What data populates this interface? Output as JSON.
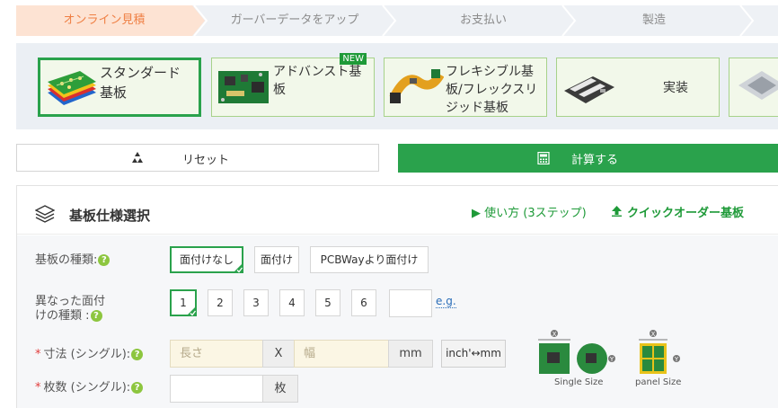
{
  "steps": [
    {
      "label": "オンライン見積",
      "active": true
    },
    {
      "label": "ガーバーデータをアップ",
      "active": false
    },
    {
      "label": "お支払い",
      "active": false
    },
    {
      "label": "製造",
      "active": false
    }
  ],
  "tiles": [
    {
      "label": "スタンダード基板",
      "selected": true
    },
    {
      "label": "アドバンスト基板",
      "badge": "NEW"
    },
    {
      "label": "フレキシブル基板/フレックスリジッド基板"
    },
    {
      "label": "実装"
    }
  ],
  "actions": {
    "reset_label": "リセット",
    "calc_label": "計算する"
  },
  "panel": {
    "title": "基板仕様選択",
    "howto_label": "▶ 使い方 (3ステップ)",
    "quick_label": "クイックオーダー基板"
  },
  "board_type": {
    "label": "基板の種類:",
    "options": [
      "面付けなし",
      "面付け",
      "PCBWayより面付け"
    ]
  },
  "panel_variants": {
    "label_line1": "異なった面付",
    "label_line2": "けの種類 :",
    "options": [
      "1",
      "2",
      "3",
      "4",
      "5",
      "6"
    ],
    "eg_label": "e.g."
  },
  "size": {
    "label": "寸法 (シングル):",
    "length_placeholder": "長さ",
    "separator": "X",
    "width_placeholder": "幅",
    "unit": "mm",
    "toggle_label": "inch'↔mm"
  },
  "quantity": {
    "label": "枚数 (シングル):",
    "unit": "枚"
  },
  "diagram": {
    "single_caption": "Single Size",
    "panel_caption": "panel Size"
  },
  "colors": {
    "accent_green": "#2aa24c",
    "step_active_bg": "#fde3d3",
    "step_active_text": "#ef7f43",
    "link_green": "#1e9a38"
  }
}
